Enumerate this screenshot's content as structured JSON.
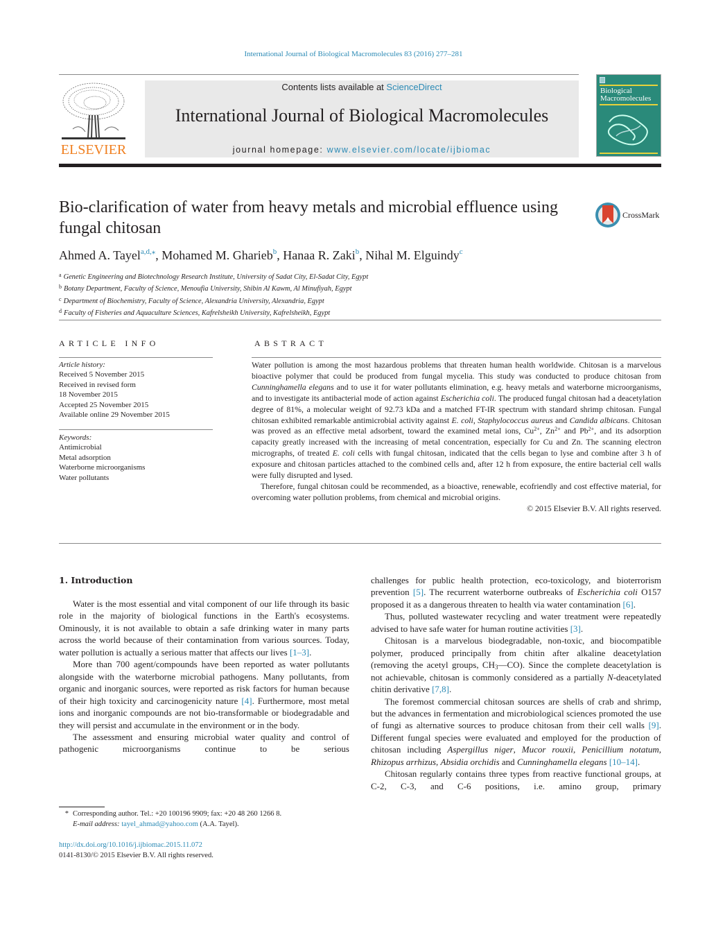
{
  "running_head": "International Journal of Biological Macromolecules 83 (2016) 277–281",
  "masthead": {
    "publisher_logo_text": "ELSEVIER",
    "contents_prefix": "Contents lists available at ",
    "contents_link": "ScienceDirect",
    "journal_title": "International Journal of Biological Macromolecules",
    "homepage_prefix": "journal homepage: ",
    "homepage_link": "www.elsevier.com/locate/ijbiomac",
    "cover_title_line1": "Biological",
    "cover_title_line2": "Macromolecules"
  },
  "article": {
    "title": "Bio-clarification of water from heavy metals and microbial effluence using fungal chitosan",
    "crossmark_label": "CrossMark",
    "authors": [
      {
        "name": "Ahmed A. Tayel",
        "sup": "a,d,⁎"
      },
      {
        "name": "Mohamed M. Gharieb",
        "sup": "b"
      },
      {
        "name": "Hanaa R. Zaki",
        "sup": "b"
      },
      {
        "name": "Nihal M. Elguindy",
        "sup": "c"
      }
    ],
    "affiliations": [
      {
        "key": "a",
        "text": "Genetic Engineering and Biotechnology Research Institute, University of Sadat City, El-Sadat City, Egypt"
      },
      {
        "key": "b",
        "text": "Botany Department, Faculty of Science, Menoufia University, Shibin Al Kawm, Al Minufiyah, Egypt"
      },
      {
        "key": "c",
        "text": "Department of Biochemistry, Faculty of Science, Alexandria University, Alexandria, Egypt"
      },
      {
        "key": "d",
        "text": "Faculty of Fisheries and Aquaculture Sciences, Kafrelsheikh University, Kafrelsheikh, Egypt"
      }
    ]
  },
  "article_info": {
    "heading": "ARTICLE INFO",
    "history_label": "Article history:",
    "history": [
      "Received 5 November 2015",
      "Received in revised form",
      "18 November 2015",
      "Accepted 25 November 2015",
      "Available online 29 November 2015"
    ],
    "keywords_label": "Keywords:",
    "keywords": [
      "Antimicrobial",
      "Metal adsorption",
      "Waterborne microorganisms",
      "Water pollutants"
    ]
  },
  "abstract": {
    "heading": "ABSTRACT",
    "p1": {
      "t1": "Water pollution is among the most hazardous problems that threaten human health worldwide. Chitosan is a marvelous bioactive polymer that could be produced from fungal mycelia. This study was conducted to produce chitosan from ",
      "i1": "Cunninghamella elegans",
      "t2": " and to use it for water pollutants elimination, e.g. heavy metals and waterborne microorganisms, and to investigate its antibacterial mode of action against ",
      "i2": "Escherichia coli",
      "t3": ". The produced fungal chitosan had a deacetylation degree of 81%, a molecular weight of 92.73 kDa and a matched FT-IR spectrum with standard shrimp chitosan. Fungal chitosan exhibited remarkable antimicrobial activity against ",
      "i3": "E. coli",
      "t4": ", ",
      "i4": "Staphylococcus aureus",
      "t5": " and ",
      "i5": "Candida albicans",
      "t6": ". Chitosan was proved as an effective metal adsorbent, toward the examined metal ions, Cu",
      "s1": "2+",
      "t7": ", Zn",
      "s2": "2+",
      "t8": " and Pb",
      "s3": "2+",
      "t9": ", and its adsorption capacity greatly increased with the increasing of metal concentration, especially for Cu and Zn. The scanning electron micrographs, of treated ",
      "i6": "E. coli",
      "t10": " cells with fungal chitosan, indicated that the cells began to lyse and combine after 3 h of exposure and chitosan particles attached to the combined cells and, after 12 h from exposure, the entire bacterial cell walls were fully disrupted and lysed."
    },
    "p2": "Therefore, fungal chitosan could be recommended, as a bioactive, renewable, ecofriendly and cost effective material, for overcoming water pollution problems, from chemical and microbial origins.",
    "copyright": "© 2015 Elsevier B.V. All rights reserved."
  },
  "body": {
    "section_heading": "1.  Introduction",
    "left": {
      "p1_text": "Water is the most essential and vital component of our life through its basic role in the majority of biological functions in the Earth's ecosystems. Ominously, it is not available to obtain a safe drinking water in many parts across the world because of their contamination from various sources. Today, water pollution is actually a serious matter that affects our lives ",
      "p1_ref": "[1–3]",
      "p1_end": ".",
      "p2_text": "More than 700 agent/compounds have been reported as water pollutants alongside with the waterborne microbial pathogens. Many pollutants, from organic and inorganic sources, were reported as risk factors for human because of their high toxicity and carcinogenicity nature ",
      "p2_ref": "[4]",
      "p2_end": ". Furthermore, most metal ions and inorganic compounds are not bio-transformable or biodegradable and they will persist and accumulate in the environment or in the body.",
      "p3_text": "The assessment and ensuring microbial water quality and control of pathogenic microorganisms continue to be serious"
    },
    "right": {
      "p1_text": "challenges for public health protection, eco-toxicology, and bioterrorism prevention ",
      "p1_ref1": "[5]",
      "p1_mid": ". The recurrent waterborne outbreaks of ",
      "p1_ital": "Escherichia coli",
      "p1_mid2": " O157 proposed it as a dangerous threaten to health via water contamination ",
      "p1_ref2": "[6]",
      "p1_end": ".",
      "p2_text": "Thus, polluted wastewater recycling and water treatment were repeatedly advised to have safe water for human routine activities ",
      "p2_ref": "[3]",
      "p2_end": ".",
      "p3_text": "Chitosan is a marvelous biodegradable, non-toxic, and biocompatible polymer, produced principally from chitin after alkaline deacetylation (removing the acetyl groups, CH",
      "p3_sub": "3",
      "p3_mid": "—CO). Since the complete deacetylation is not achievable, chitosan is commonly considered as a partially ",
      "p3_ital": "N",
      "p3_mid2": "-deacetylated chitin derivative ",
      "p3_ref": "[7,8]",
      "p3_end": ".",
      "p4_text": "The foremost commercial chitosan sources are shells of crab and shrimp, but the advances in fermentation and microbiological sciences promoted the use of fungi as alternative sources to produce chitosan from their cell walls ",
      "p4_ref1": "[9]",
      "p4_mid": ". Different fungal species were evaluated and employed for the production of chitosan including ",
      "p4_sp1": "Aspergillus niger",
      "p4_c1": ", ",
      "p4_sp2": "Mucor rouxii",
      "p4_c2": ", ",
      "p4_sp3": "Penicillium notatum",
      "p4_c3": ", ",
      "p4_sp4": "Rhizopus arrhizus",
      "p4_c4": ", ",
      "p4_sp5": "Absidia orchidis",
      "p4_and": " and ",
      "p4_sp6": "Cunninghamella elegans",
      "p4_sp_end": " ",
      "p4_ref2": "[10–14]",
      "p4_end": ".",
      "p5_text": "Chitosan regularly contains three types from reactive functional groups, at C-2, C-3, and C-6 positions, i.e. amino group, primary"
    }
  },
  "footnote": {
    "star": "*",
    "corresponding": "Corresponding author. Tel.: +20 100196 9909; fax: +20 48 260 1266 8.",
    "email_label": "E-mail address: ",
    "email": "tayel_ahmad@yahoo.com",
    "email_suffix": " (A.A. Tayel).",
    "doi": "http://dx.doi.org/10.1016/j.ijbiomac.2015.11.072",
    "issn_line": "0141-8130/© 2015 Elsevier B.V. All rights reserved."
  },
  "colors": {
    "link": "#2b8ab5",
    "elsevier_orange": "#f07f1f",
    "masthead_bg": "#e9e9e9",
    "cover_green": "#2a8a7a",
    "crossmark_red": "#d9432f",
    "crossmark_teal": "#3b8fb0"
  }
}
